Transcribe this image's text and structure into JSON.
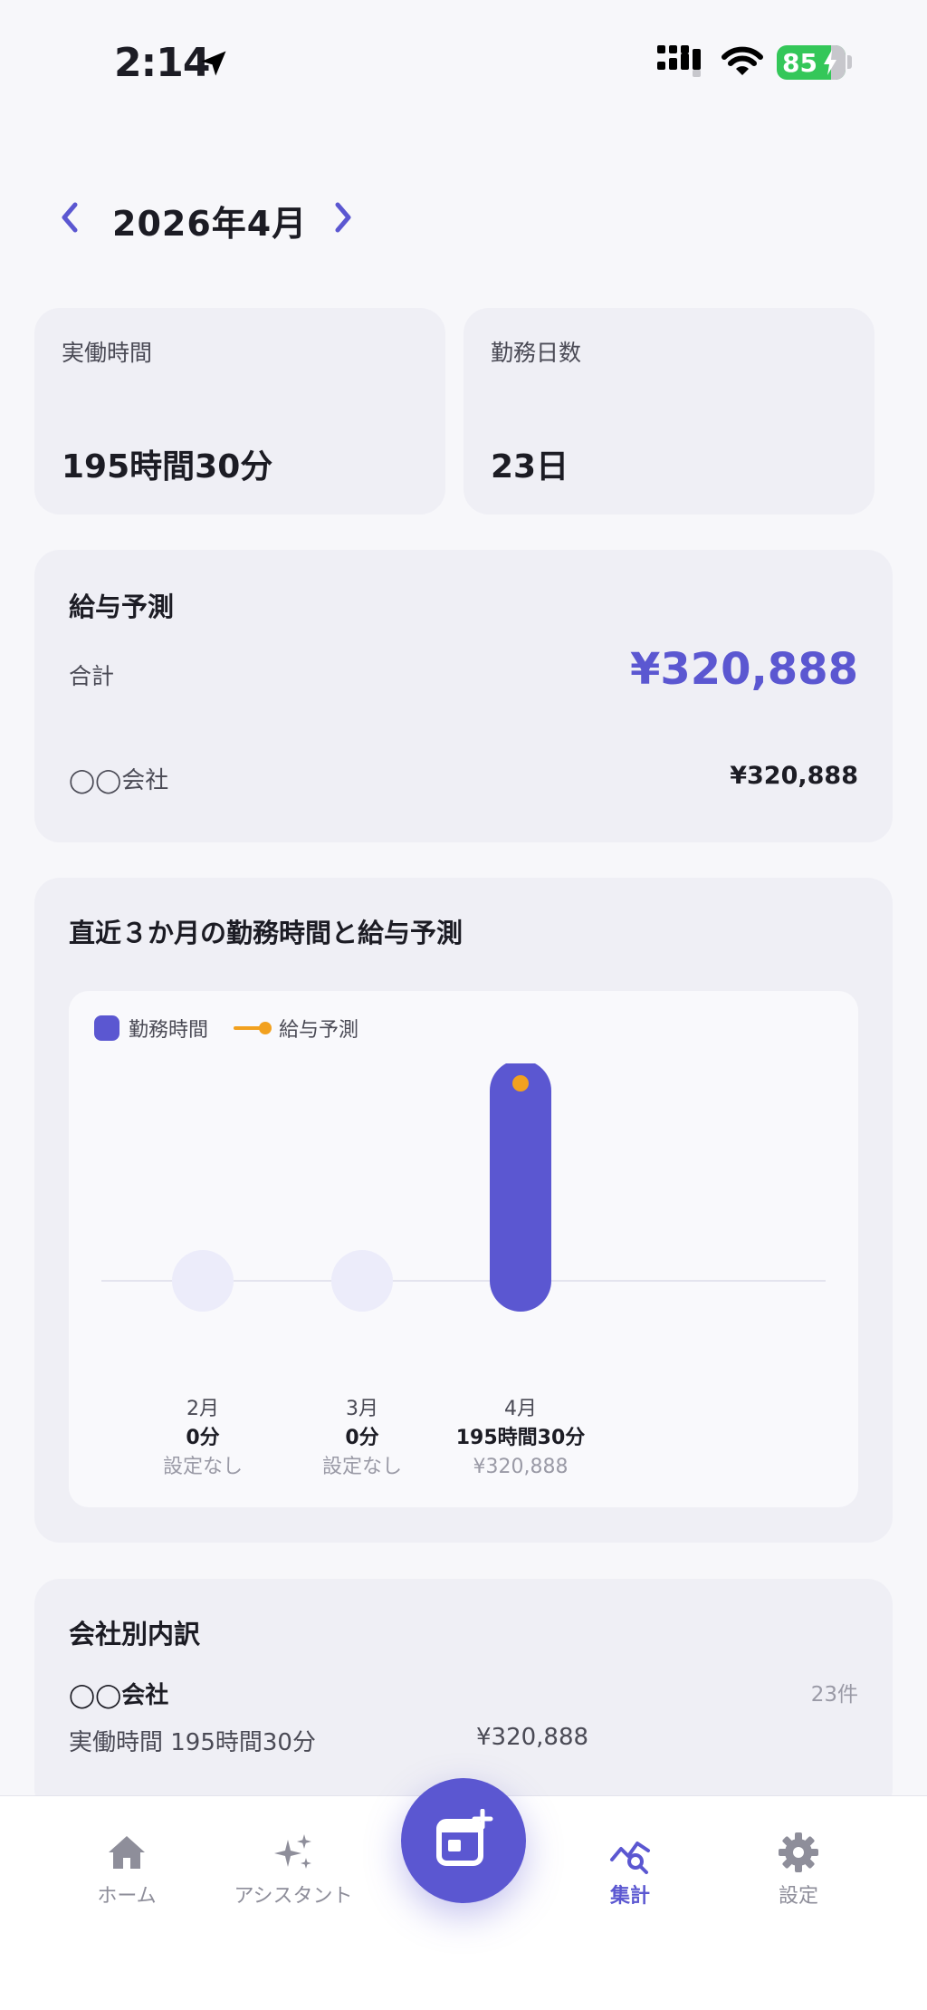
{
  "status_bar": {
    "time": "2:14",
    "battery": "85"
  },
  "month_nav": {
    "title": "2026年4月"
  },
  "stats": [
    {
      "label": "実働時間",
      "value": "195時間30分"
    },
    {
      "label": "勤務日数",
      "value": "23日"
    }
  ],
  "salary": {
    "title": "給与予測",
    "total_label": "合計",
    "total_value": "¥320,888",
    "company_name": "◯◯会社",
    "company_value": "¥320,888"
  },
  "chart_data": {
    "type": "bar",
    "title": "直近３か月の勤務時間と給与予測",
    "legend": [
      "勤務時間",
      "給与予測"
    ],
    "categories": [
      "2月",
      "3月",
      "4月"
    ],
    "series": [
      {
        "name": "勤務時間",
        "values": [
          0,
          0,
          195.5
        ],
        "labels": [
          "0分",
          "0分",
          "195時間30分"
        ]
      },
      {
        "name": "給与予測",
        "values": [
          null,
          null,
          320888
        ],
        "labels": [
          "設定なし",
          "設定なし",
          "¥320,888"
        ]
      }
    ],
    "colors": {
      "hours": "#5b57d1",
      "salary": "#f2a11f",
      "empty": "#ececfa"
    }
  },
  "breakdown": {
    "title": "会社別内訳",
    "company": "◯◯会社",
    "count": "23件",
    "hours": "実働時間 195時間30分",
    "salary": "¥320,888"
  },
  "tabs": [
    {
      "label": "ホーム",
      "icon": "home-icon"
    },
    {
      "label": "アシスタント",
      "icon": "sparkles-icon"
    },
    {
      "label": "集計",
      "icon": "analytics-icon"
    },
    {
      "label": "設定",
      "icon": "gear-icon"
    }
  ],
  "fab": {
    "icon": "calendar-add-icon"
  },
  "colors": {
    "accent": "#5b57d1",
    "orange": "#f2a11f",
    "background": "#f7f7fa"
  }
}
